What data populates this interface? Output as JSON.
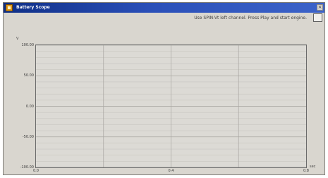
{
  "window": {
    "title": "Battery Scope",
    "close_glyph": "×"
  },
  "toolbar": {
    "instruction": "Use SPIN-Vt left channel. Press Play and start engine.",
    "config_button_icon": "settings-box-icon"
  },
  "chart_data": {
    "type": "line",
    "title": "",
    "xlabel": "sec",
    "ylabel": "V",
    "xlim": [
      0,
      0.8
    ],
    "ylim": [
      -100.0,
      100.0
    ],
    "x_ticks": [
      "0.0",
      "0.4",
      "0.8"
    ],
    "y_ticks": [
      "100.00",
      "50.00",
      "0.00",
      "-50.00",
      "-100.00"
    ],
    "grid": true,
    "series": []
  },
  "colors": {
    "plot_bg": "#dcdad5",
    "grid_major": "#a9a7a2",
    "grid_minor": "#c8c6c1"
  }
}
